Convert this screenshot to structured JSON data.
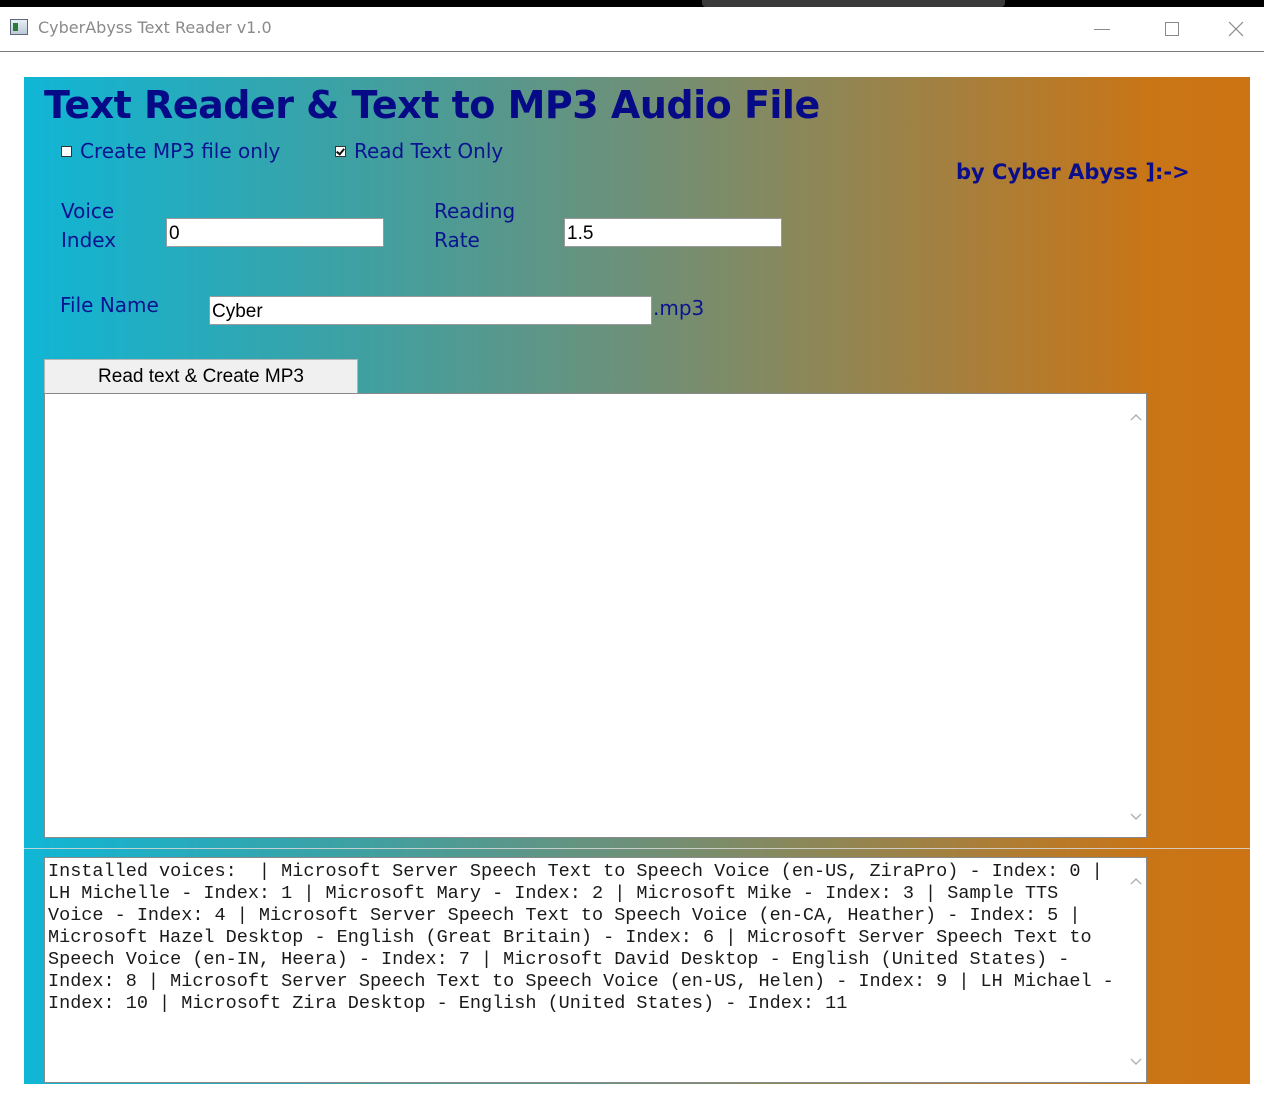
{
  "window": {
    "title": "CyberAbyss Text Reader v1.0"
  },
  "app": {
    "heading": "Text Reader & Text to MP3 Audio File",
    "byline": "by Cyber Abyss ]:->",
    "options": {
      "create_mp3_label": "Create MP3 file only",
      "create_mp3_checked": false,
      "read_text_label": "Read Text Only",
      "read_text_checked": true
    },
    "voice_index": {
      "label_line1": "Voice",
      "label_line2": "Index",
      "value": "0"
    },
    "reading_rate": {
      "label_line1": "Reading",
      "label_line2": "Rate",
      "value": "1.5"
    },
    "file_name": {
      "label": "File Name",
      "value": "Cyber",
      "extension": ".mp3"
    },
    "action_button_label": "Read text & Create MP3",
    "text_input": {
      "value": ""
    },
    "voices_log": "Installed voices:  | Microsoft Server Speech Text to Speech Voice (en-US, ZiraPro) - Index: 0 | LH Michelle - Index: 1 | Microsoft Mary - Index: 2 | Microsoft Mike - Index: 3 | Sample TTS Voice - Index: 4 | Microsoft Server Speech Text to Speech Voice (en-CA, Heather) - Index: 5 | Microsoft Hazel Desktop - English (Great Britain) - Index: 6 | Microsoft Server Speech Text to Speech Voice (en-IN, Heera) - Index: 7 | Microsoft David Desktop - English (United States) - Index: 8 | Microsoft Server Speech Text to Speech Voice (en-US, Helen) - Index: 9 | LH Michael - Index: 10 | Microsoft Zira Desktop - English (United States) - Index: 11"
  },
  "colors": {
    "heading": "#070a86",
    "label": "#0b1490",
    "gradient_start": "#10b6d6",
    "gradient_end": "#cc7414"
  },
  "icons": [
    "app-icon",
    "minimize-icon",
    "maximize-icon",
    "close-icon",
    "scroll-up-icon",
    "scroll-down-icon"
  ]
}
